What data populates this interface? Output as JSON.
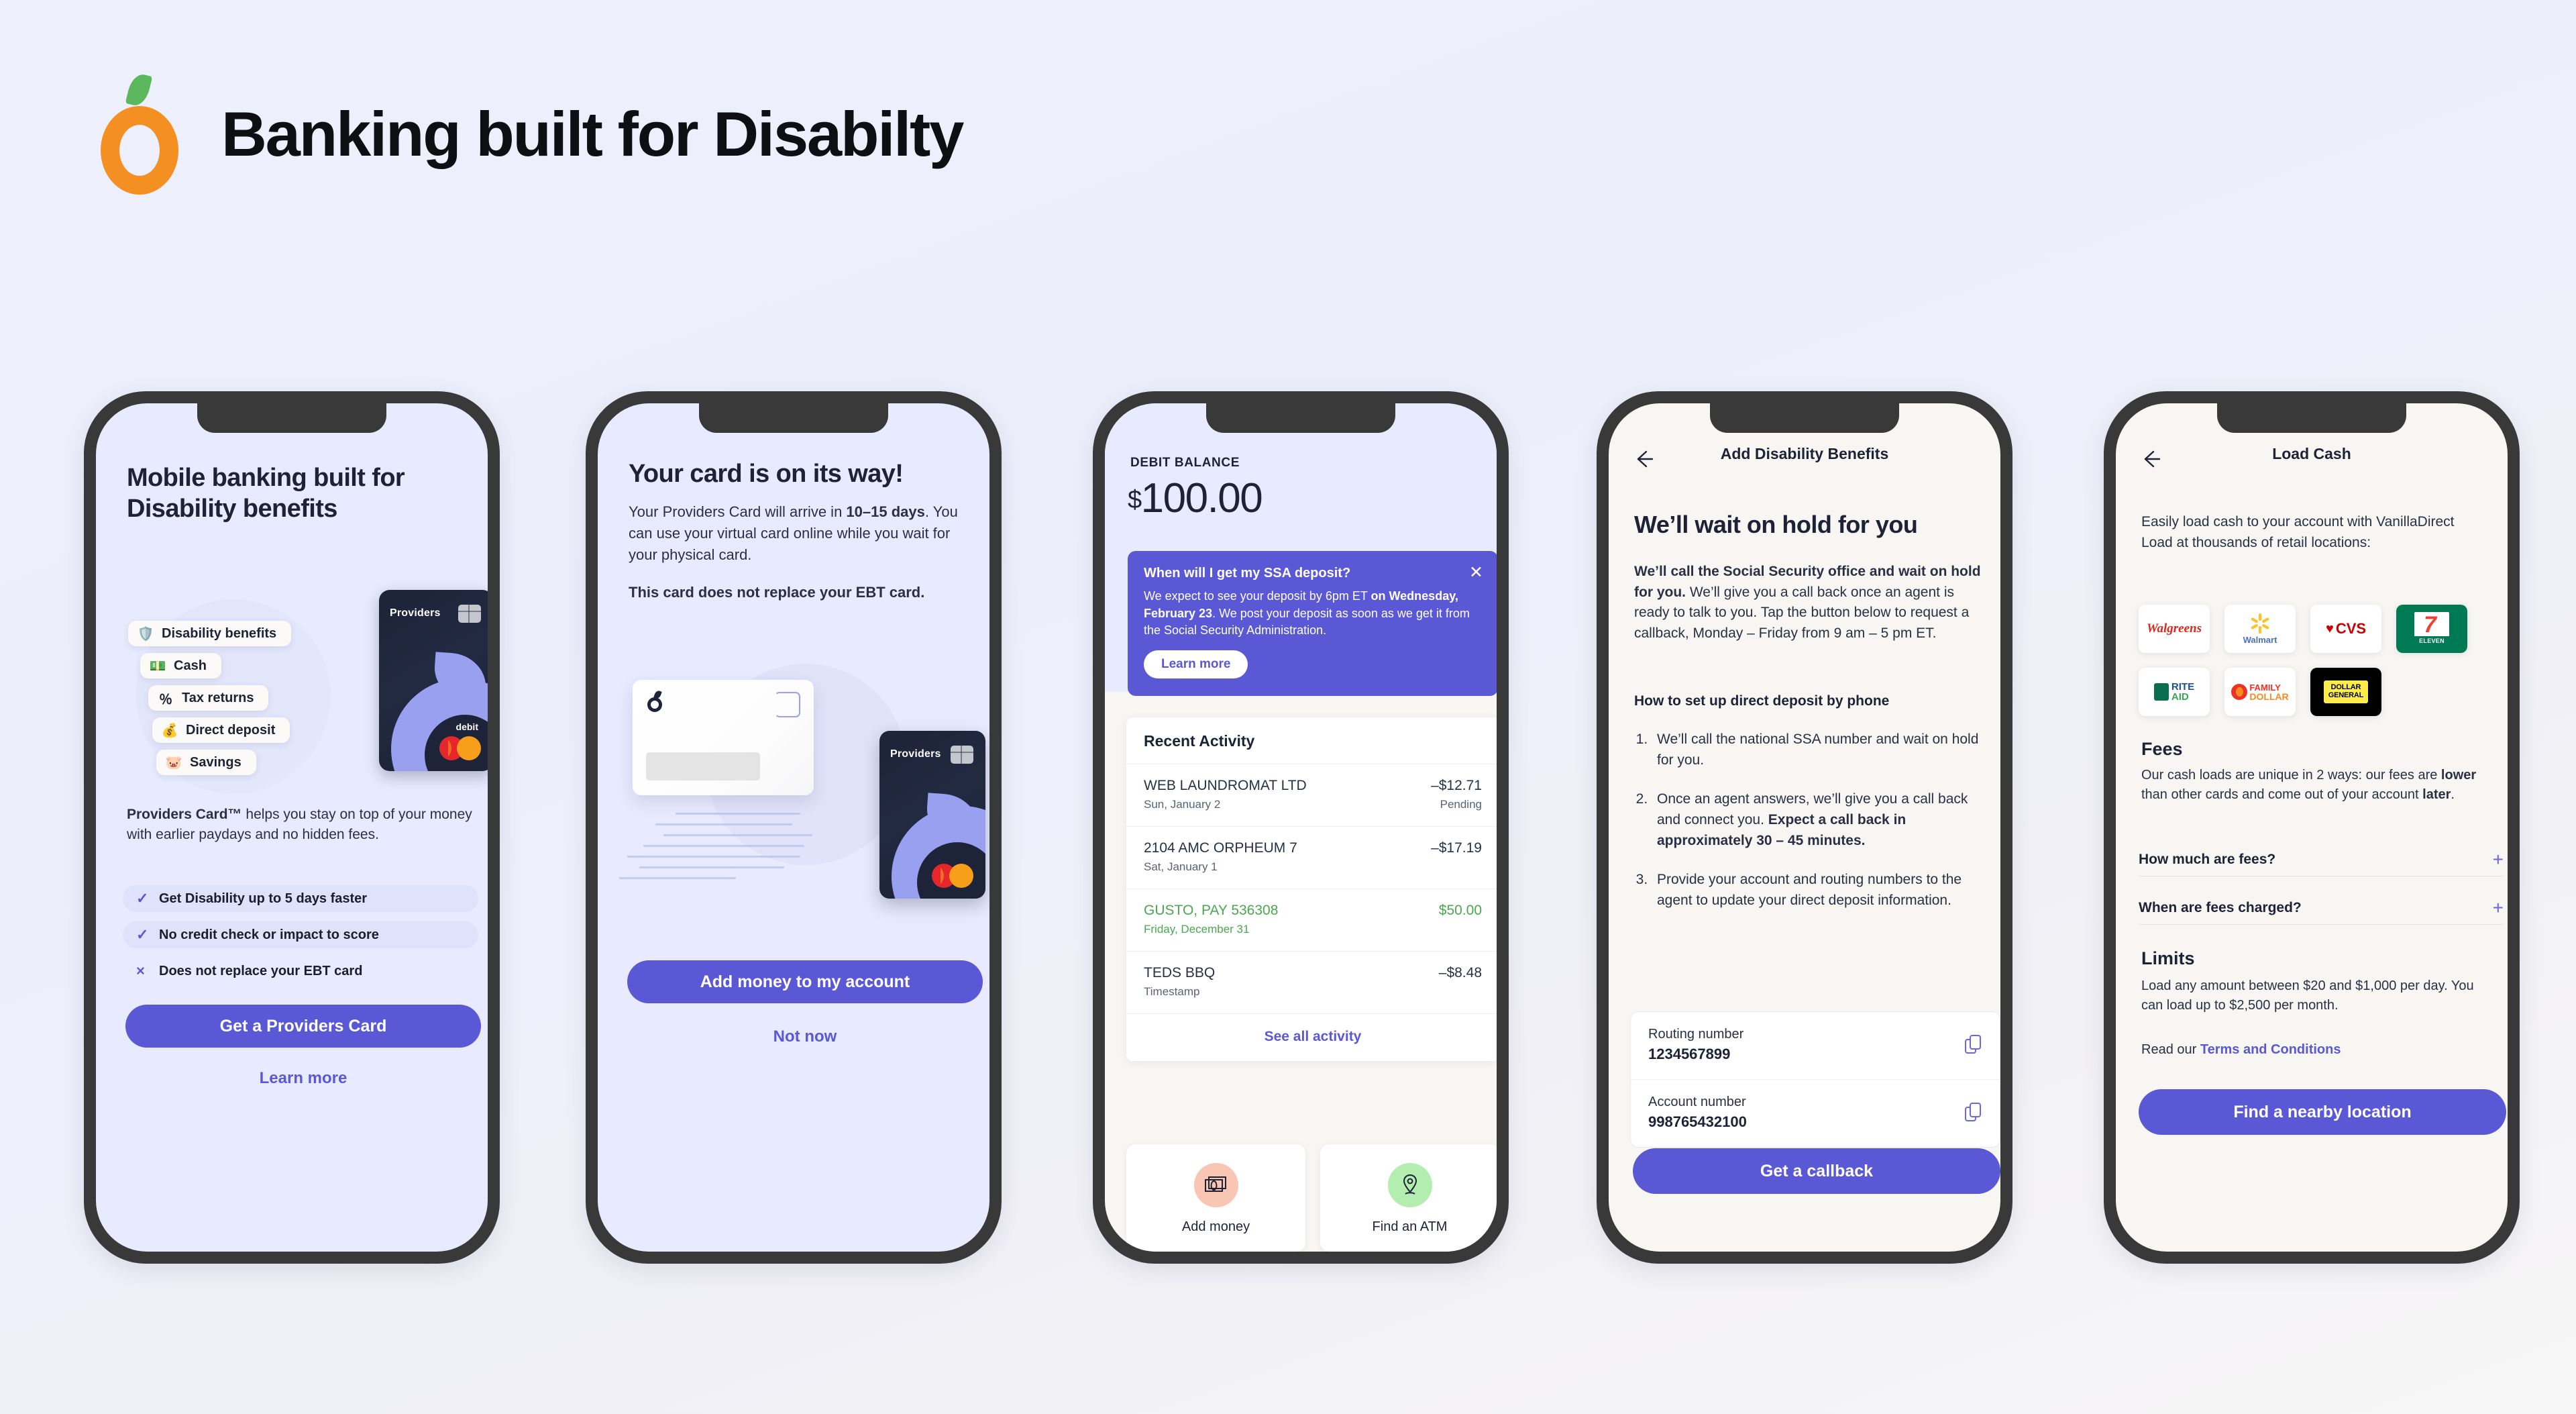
{
  "header": {
    "title": "Banking built for Disabilty",
    "logo_icon": "orange-fruit-logo"
  },
  "phones": [
    {
      "id": "onboarding",
      "heading": "Mobile banking built for Disability benefits",
      "card_illustration": {
        "card_brand": "Providers",
        "card_type_label": "debit",
        "network_icon": "mastercard-logo",
        "chips": [
          {
            "label": "Disability benefits",
            "icon": "shield-icon"
          },
          {
            "label": "Cash",
            "icon": "atm-cash-icon"
          },
          {
            "label": "Tax returns",
            "icon": "percent-icon"
          },
          {
            "label": "Direct deposit",
            "icon": "coin-deposit-icon"
          },
          {
            "label": "Savings",
            "icon": "piggy-bank-icon"
          }
        ]
      },
      "description_bold": "Providers Card™",
      "description_rest": " helps you stay on top of your money with earlier paydays and no hidden fees.",
      "bullets": [
        {
          "mark": "✓",
          "label": "Get Disability up to 5 days faster",
          "highlight": true
        },
        {
          "mark": "✓",
          "label": "No credit check or impact to score",
          "highlight": true
        },
        {
          "mark": "×",
          "label": "Does not replace your EBT card",
          "highlight": false
        }
      ],
      "primary_button": "Get a Providers Card",
      "secondary_link": "Learn more"
    },
    {
      "id": "card-on-its-way",
      "heading": "Your card is on its way!",
      "body_pre": "Your Providers Card will arrive in ",
      "body_bold": "10–15 days",
      "body_post": ". You can use your virtual card online while you wait for your physical card.",
      "note": "This card does not replace your EBT card.",
      "card_brand": "Providers",
      "primary_button": "Add money to my account",
      "secondary_link": "Not now"
    },
    {
      "id": "debit-balance",
      "balance_label": "DEBIT BALANCE",
      "balance_currency": "$",
      "balance_amount": "100.00",
      "banner": {
        "title": "When will I get my SSA deposit?",
        "close_icon": "close-icon",
        "text_pre": "We expect to see your deposit by 6pm ET ",
        "text_bold": "on Wednesday, February 23",
        "text_post": ". We post your deposit as soon as we get it from the Social Security Administration.",
        "button": "Learn more"
      },
      "activity_title": "Recent Activity",
      "activity": [
        {
          "name": "WEB LAUNDROMAT LTD",
          "date": "Sun, January 2",
          "amount": "–$12.71",
          "status": "Pending",
          "positive": false
        },
        {
          "name": "2104 AMC ORPHEUM 7",
          "date": "Sat, January 1",
          "amount": "–$17.19",
          "status": "",
          "positive": false
        },
        {
          "name": "GUSTO, PAY 536308",
          "date": "Friday, December 31",
          "amount": "$50.00",
          "status": "",
          "positive": true
        },
        {
          "name": "TEDS BBQ",
          "date": "Timestamp",
          "amount": "–$8.48",
          "status": "",
          "positive": false
        }
      ],
      "see_all": "See all activity",
      "tiles": [
        {
          "label": "Add money",
          "icon": "cash-bills-icon"
        },
        {
          "label": "Find an ATM",
          "icon": "map-pin-icon"
        }
      ]
    },
    {
      "id": "add-disability-benefits",
      "nav_title": "Add Disability Benefits",
      "back_icon": "arrow-left-icon",
      "heading": "We’ll wait on hold for you",
      "para_bold": "We’ll call the Social Security office and wait on hold for you.",
      "para_rest": " We’ll give you a call back once an agent is ready to talk to you. Tap the button below to request a callback, Monday – Friday from 9 am – 5 pm ET.",
      "subhead": "How to set up direct deposit by phone",
      "steps": [
        {
          "text": "We’ll call the national SSA number and wait on hold for you.",
          "bold": ""
        },
        {
          "text": "Once an agent answers, we’ll give you a call back and connect you. ",
          "bold": "Expect a call back in approximately 30 – 45 minutes."
        },
        {
          "text": "Provide your account and routing numbers to the agent to update your direct deposit information.",
          "bold": ""
        }
      ],
      "fields": [
        {
          "label": "Routing number",
          "value": "1234567899",
          "copy_icon": "copy-icon"
        },
        {
          "label": "Account number",
          "value": "998765432100",
          "copy_icon": "copy-icon"
        }
      ],
      "primary_button": "Get a callback"
    },
    {
      "id": "load-cash",
      "nav_title": "Load Cash",
      "back_icon": "arrow-left-icon",
      "intro": "Easily load cash to your account with VanillaDirect Load at thousands of retail locations:",
      "retailers": [
        {
          "name": "Walgreens",
          "logo": "walgreens-logo"
        },
        {
          "name": "Walmart",
          "logo": "walmart-logo"
        },
        {
          "name": "CVS",
          "logo": "cvs-logo"
        },
        {
          "name": "7-Eleven",
          "logo": "seven-eleven-logo"
        },
        {
          "name": "Rite Aid",
          "logo": "rite-aid-logo"
        },
        {
          "name": "Family Dollar",
          "logo": "family-dollar-logo"
        },
        {
          "name": "Dollar General",
          "logo": "dollar-general-logo"
        }
      ],
      "fees_heading": "Fees",
      "fees_text_1": "Our cash loads are unique in 2 ways: our fees are ",
      "fees_bold_1": "lower",
      "fees_text_2": " than other cards and come out of your account ",
      "fees_bold_2": "later",
      "fees_text_3": ".",
      "accordions": [
        {
          "question": "How much are fees?",
          "icon": "plus-icon"
        },
        {
          "question": "When are fees charged?",
          "icon": "plus-icon"
        }
      ],
      "limits_heading": "Limits",
      "limits_text": "Load any amount between $20 and $1,000 per day. You can load up to $2,500 per month.",
      "terms_pre": "Read our ",
      "terms_link": "Terms and Conditions",
      "primary_button": "Find a nearby location"
    }
  ],
  "colors": {
    "accent": "#5b58d6",
    "dark": "#1e2236",
    "positive": "#4aa84f",
    "orange": "#f49022",
    "leaf_green": "#5cb85c"
  }
}
